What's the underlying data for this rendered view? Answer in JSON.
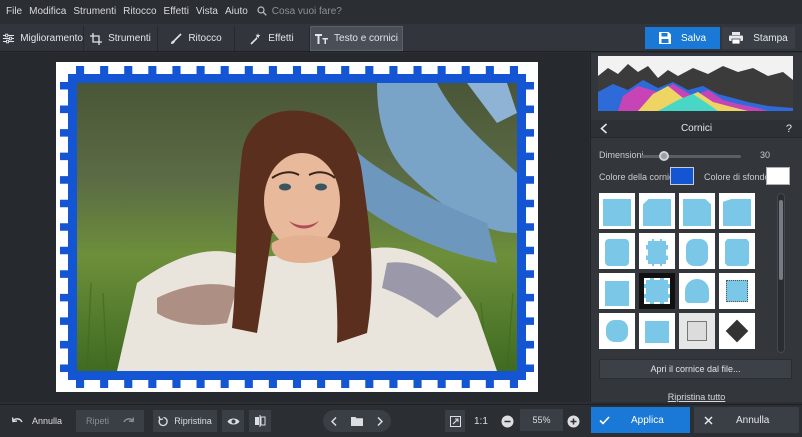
{
  "menu": [
    "File",
    "Modifica",
    "Strumenti",
    "Ritocco",
    "Effetti",
    "Vista",
    "Aiuto"
  ],
  "search": {
    "placeholder": "Cosa vuoi fare?"
  },
  "tabs": [
    {
      "label": "Miglioramento",
      "icon": "sliders-icon"
    },
    {
      "label": "Strumenti",
      "icon": "crop-icon"
    },
    {
      "label": "Ritocco",
      "icon": "brush-icon"
    },
    {
      "label": "Effetti",
      "icon": "magic-wand-icon"
    },
    {
      "label": "Testo e cornici",
      "icon": "text-icon",
      "active": true
    }
  ],
  "actions": {
    "save": "Salva",
    "print": "Stampa"
  },
  "panel": {
    "title": "Cornici",
    "help": "?",
    "size_label": "Dimensioni",
    "size_value": "30",
    "size_level": 0.23,
    "frame_color_label": "Colore della cornice:",
    "bg_color_label": "Colore di sfondo:",
    "frame_color": "#1355d3",
    "bg_color": "#ffffff",
    "open_frame_label": "Apri il cornice dal file...",
    "reset_all": "Ripristina tutto"
  },
  "bottom": {
    "undo": "Annulla",
    "redo": "Ripeti",
    "restore": "Ripristina",
    "one_to_one": "1:1",
    "zoom": "55%",
    "apply": "Applica",
    "cancel": "Annulla"
  },
  "colors": {
    "accent": "#1a78d6",
    "frame_blue": "#1355d3",
    "thumb_fill": "#7bc7e7"
  }
}
